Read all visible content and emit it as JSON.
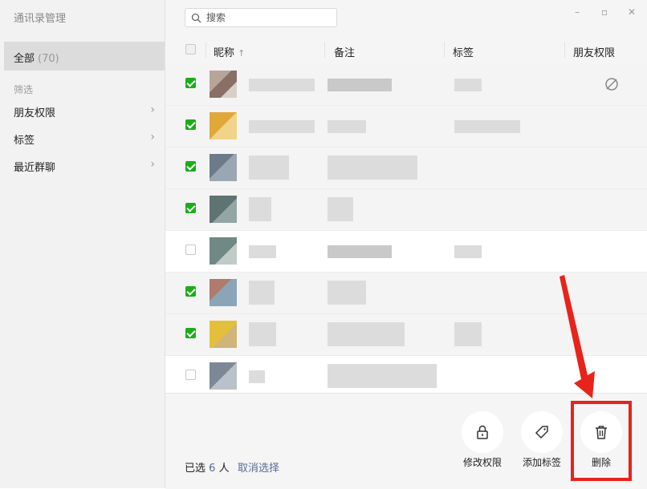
{
  "app": {
    "title": "通讯录管理"
  },
  "sidebar": {
    "all_label": "全部",
    "all_count": "(70)",
    "filter_title": "筛选",
    "items": [
      {
        "label": "朋友权限",
        "icon": "chevron-right-icon"
      },
      {
        "label": "标签",
        "icon": "chevron-right-icon"
      },
      {
        "label": "最近群聊",
        "icon": "chevron-right-icon"
      }
    ]
  },
  "search": {
    "placeholder": "搜索",
    "icon": "search-icon"
  },
  "window_controls": [
    "minimize",
    "maximize",
    "close"
  ],
  "table": {
    "columns": {
      "nickname": "昵称",
      "sort_indicator": "↑",
      "remark": "备注",
      "tag": "标签",
      "permission": "朋友权限"
    },
    "rows": [
      {
        "checked": true
      },
      {
        "checked": true
      },
      {
        "checked": true
      },
      {
        "checked": true
      },
      {
        "checked": false
      },
      {
        "checked": true
      },
      {
        "checked": true
      },
      {
        "checked": false
      }
    ]
  },
  "footer": {
    "selected_prefix": "已选",
    "selected_count": "6",
    "selected_suffix": "人",
    "cancel_selection": "取消选择",
    "actions": {
      "modify_permission": "修改权限",
      "add_tag": "添加标签",
      "delete": "删除"
    }
  },
  "colors": {
    "accent_green": "#1aad19",
    "link_blue": "#576b95",
    "annotation_red": "#e8231b"
  }
}
